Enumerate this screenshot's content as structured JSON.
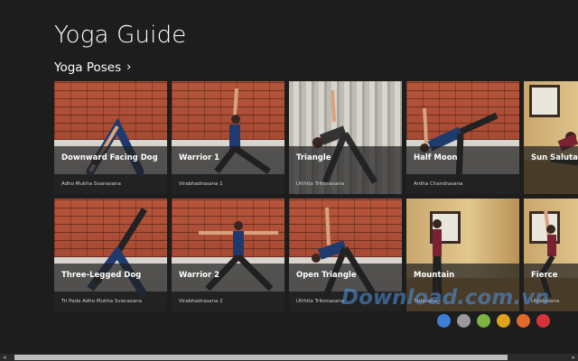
{
  "app_title": "Yoga Guide",
  "section": {
    "label": "Yoga Poses",
    "chevron": "›"
  },
  "poses": [
    {
      "name": "Downward Facing Dog",
      "sanskrit": "Adho Mukha Svanasana"
    },
    {
      "name": "Warrior 1",
      "sanskrit": "Virabhadrasana 1"
    },
    {
      "name": "Triangle",
      "sanskrit": "Utthita Trikonasana"
    },
    {
      "name": "Half Moon",
      "sanskrit": "Ardha Chandrasana"
    },
    {
      "name": "Sun Salutation",
      "sanskrit": ""
    },
    {
      "name": "Three-Legged Dog",
      "sanskrit": "Tri Pada Adho Mukha Svanasana"
    },
    {
      "name": "Warrior 2",
      "sanskrit": "Virabhadrasana 2"
    },
    {
      "name": "Open Triangle",
      "sanskrit": "Utthita Trikonasana"
    },
    {
      "name": "Mountain",
      "sanskrit": "Tadasana"
    },
    {
      "name": "Fierce",
      "sanskrit": "Utkatasana"
    }
  ],
  "scrollbar": {
    "left_arrow": "◂",
    "right_arrow": "▸"
  },
  "watermark": {
    "text": "Download.com.vn",
    "dot_colors": [
      "#3d7fd6",
      "#9a9a9a",
      "#7cb342",
      "#e0a21a",
      "#e06a2a",
      "#d8333a"
    ]
  }
}
